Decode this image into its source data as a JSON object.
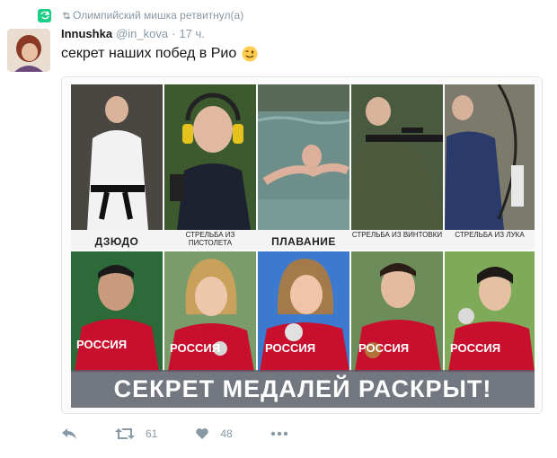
{
  "retweet_notice": {
    "text": "Олимпийский мишка ретвитнул(а)",
    "icon": "retweet-icon"
  },
  "tweet": {
    "author_name": "Innushka",
    "author_handle": "@in_kova",
    "separator": "·",
    "time": "17 ч.",
    "text": "секрет наших побед в Рио",
    "emoji": "winking-face"
  },
  "media": {
    "top_captions": [
      "ДЗЮДО",
      "СТРЕЛЬБА ИЗ ПИСТОЛЕТА",
      "ПЛАВАНИЕ",
      "СТРЕЛЬБА ИЗ ВИНТОВКИ",
      "СТРЕЛЬБА ИЗ ЛУКА"
    ],
    "jersey_text": "РОССИЯ",
    "banner_text": "СЕКРЕТ МЕДАЛЕЙ РАСКРЫТ!"
  },
  "actions": {
    "reply": {
      "icon": "reply-icon",
      "count": ""
    },
    "retweet": {
      "icon": "retweet-icon",
      "count": "61"
    },
    "like": {
      "icon": "heart-icon",
      "count": "48"
    },
    "more": {
      "icon": "more-icon"
    }
  },
  "colors": {
    "retweet_green": "#19cf86",
    "muted": "#8899a6",
    "text": "#14171a",
    "jersey_red": "#c8102e"
  }
}
